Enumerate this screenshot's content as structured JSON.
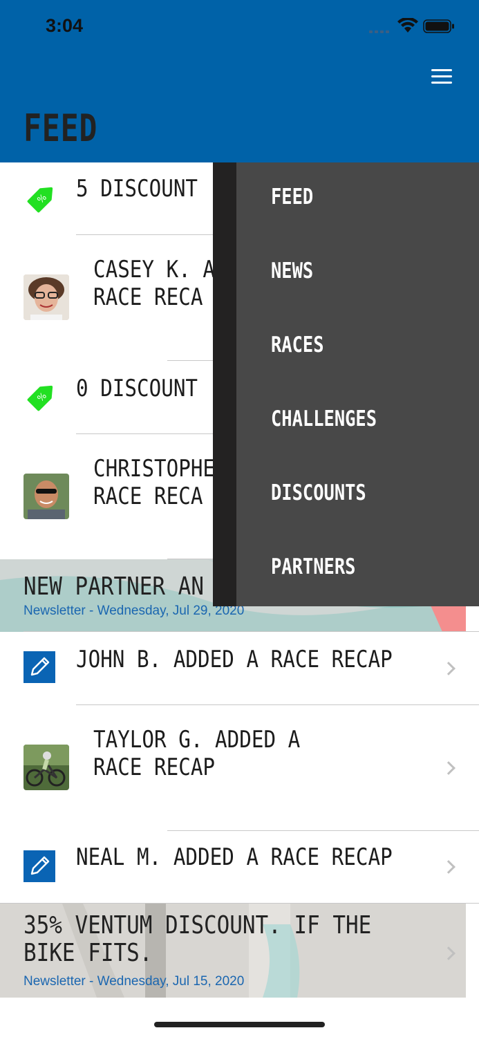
{
  "status_bar": {
    "time": "3:04"
  },
  "header": {
    "title": "FEED"
  },
  "feed": [
    {
      "type": "discount",
      "title": "5 DISCOUNT"
    },
    {
      "type": "user",
      "title_line1": "CASEY K. A",
      "title_line2": "RACE RECA"
    },
    {
      "type": "discount",
      "title": "0 DISCOUNT"
    },
    {
      "type": "user",
      "title_line1": "CHRISTOPHE",
      "title_line2": "RACE RECA"
    },
    {
      "type": "newsletter",
      "title": "NEW PARTNER AN",
      "meta": "Newsletter - Wednesday, Jul 29, 2020"
    },
    {
      "type": "recap",
      "title": "JOHN B. ADDED A RACE RECAP"
    },
    {
      "type": "user",
      "title_line1": "TAYLOR G. ADDED A",
      "title_line2": "RACE RECAP"
    },
    {
      "type": "recap",
      "title": "NEAL M. ADDED A RACE RECAP"
    },
    {
      "type": "newsletter",
      "title_line1": "35% VENTUM DISCOUNT. IF THE",
      "title_line2": "BIKE FITS.",
      "meta": "Newsletter - Wednesday, Jul 15, 2020"
    }
  ],
  "drawer": {
    "items": [
      "FEED",
      "NEWS",
      "RACES",
      "CHALLENGES",
      "DISCOUNTS",
      "PARTNERS"
    ]
  },
  "colors": {
    "header_bg": "#0062a8",
    "drawer_bg": "#484848",
    "discount_tag": "#22e022",
    "pencil_bg": "#0a64b4",
    "newsletter_meta": "#1a66b0"
  },
  "icons": {
    "menu": "hamburger-icon",
    "discount": "price-tag-icon",
    "recap": "pencil-icon",
    "chevron": "chevron-right-icon"
  }
}
